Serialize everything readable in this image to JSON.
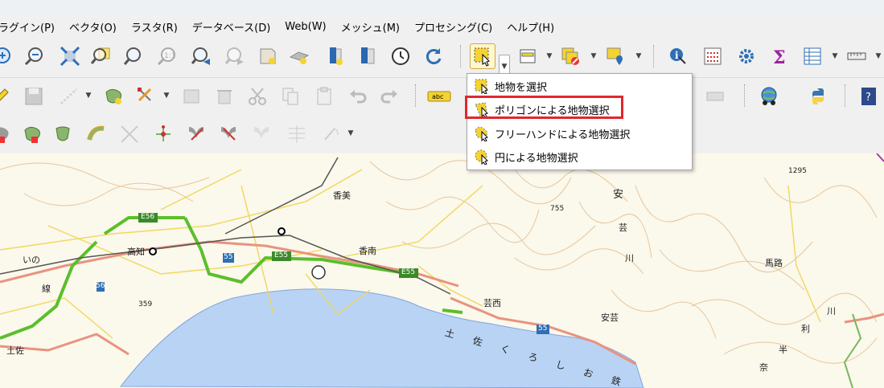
{
  "menu": {
    "items": [
      "ラグイン(P)",
      "ベクタ(O)",
      "ラスタ(R)",
      "データベース(D)",
      "Web(W)",
      "メッシュ(M)",
      "プロセシング(C)",
      "ヘルプ(H)"
    ]
  },
  "toolbar": {
    "select_tool_icon": "select-features-icon",
    "abc_label": "abc"
  },
  "dropdown": {
    "items": [
      {
        "label": "地物を選択",
        "icon": "select-rectangle-icon"
      },
      {
        "label": "ポリゴンによる地物選択",
        "icon": "select-polygon-icon"
      },
      {
        "label": "フリーハンドによる地物選択",
        "icon": "select-freehand-icon"
      },
      {
        "label": "円による地物選択",
        "icon": "select-radius-icon"
      }
    ],
    "highlighted_index": 1
  },
  "map": {
    "labels": {
      "kami": "香美",
      "konan": "香南",
      "kochi": "高知",
      "ino": "いの",
      "geisei": "芸西",
      "aki": "安芸",
      "tosa": "土佐",
      "umaji": "馬路",
      "e56": "E56",
      "e55a": "E55",
      "e55b": "E55",
      "r55": "55",
      "r56": "56",
      "r55b": "55",
      "elev_1295": "1295",
      "elev_755": "755",
      "elev_359": "359",
      "an": "安",
      "gei": "芸",
      "kawa": "川",
      "bay_text": "土 佐 く ろ し お 鉄",
      "right1": "奈",
      "right2": "半",
      "right3": "利",
      "right4": "川",
      "kami_ku": "線"
    }
  },
  "colors": {
    "highlight_border": "#e3262c",
    "sea": "#b9d3f5",
    "expressway": "#5bbf2b",
    "national_road": "#e8937f"
  }
}
